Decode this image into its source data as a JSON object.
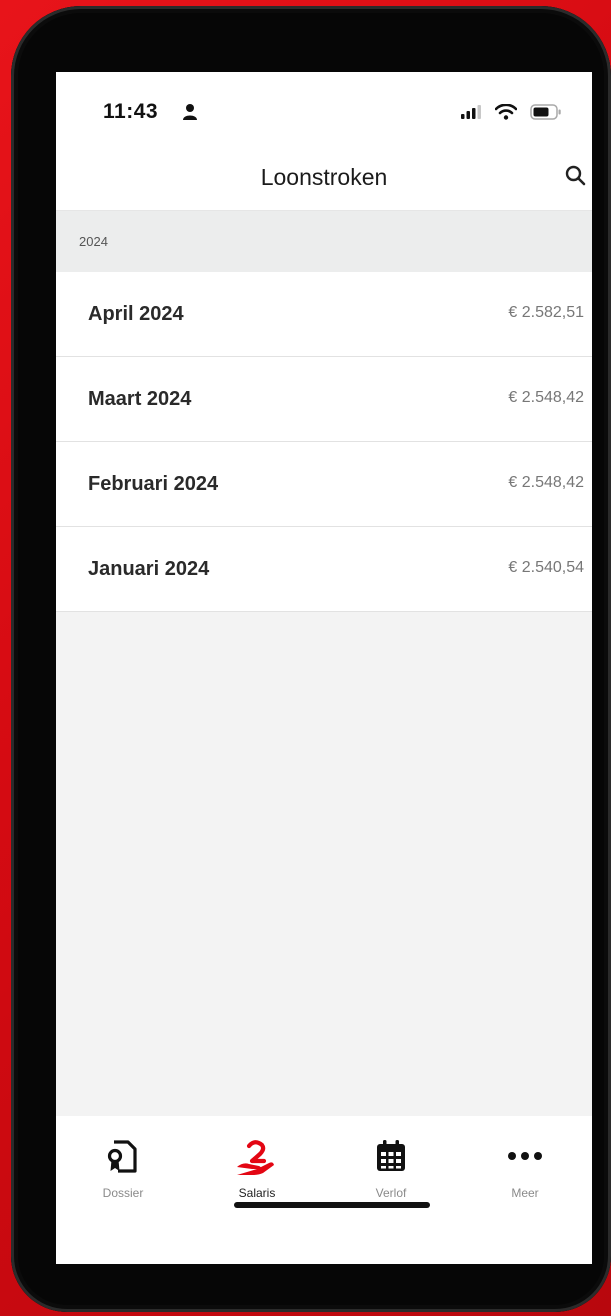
{
  "status_bar": {
    "time": "11:43"
  },
  "header": {
    "title": "Loonstroken"
  },
  "section": {
    "label": "2024"
  },
  "payslips": [
    {
      "label": "April 2024",
      "amount": "€ 2.582,51"
    },
    {
      "label": "Maart 2024",
      "amount": "€ 2.548,42"
    },
    {
      "label": "Februari 2024",
      "amount": "€ 2.548,42"
    },
    {
      "label": "Januari 2024",
      "amount": "€ 2.540,54"
    }
  ],
  "tabs": [
    {
      "label": "Dossier",
      "icon": "dossier-icon",
      "active": false
    },
    {
      "label": "Salaris",
      "icon": "salary-hand-icon",
      "active": true
    },
    {
      "label": "Verlof",
      "icon": "calendar-icon",
      "active": false
    },
    {
      "label": "Meer",
      "icon": "more-icon",
      "active": false
    }
  ],
  "colors": {
    "accent": "#e30613",
    "background_brand": "#e8141a",
    "screen_background": "#f3f3f3",
    "section_background": "#eceded"
  }
}
